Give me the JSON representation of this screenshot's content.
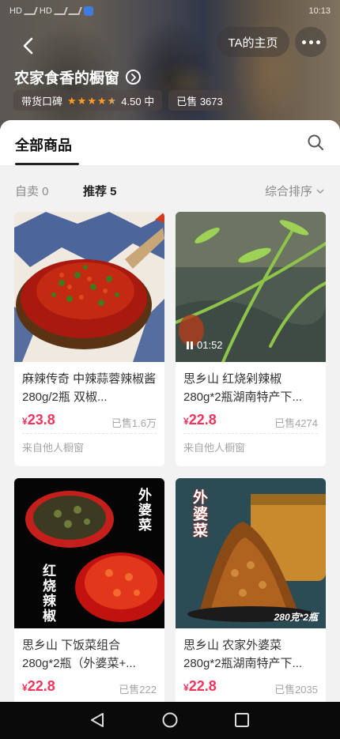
{
  "status_bar": {
    "carrier_1": "HD",
    "carrier_2": "HD",
    "time": "10:13"
  },
  "header": {
    "home_button_label": "TA的主页",
    "shop_name": "农家食香的橱窗",
    "rating_label": "带货口碑",
    "rating_value": 4.5,
    "rating_text": "4.50 中",
    "sold_text": "已售 3673"
  },
  "tabs": {
    "all_products": "全部商品"
  },
  "filters": {
    "self_sold": "自卖 0",
    "recommended": "推荐 5",
    "sort": "综合排序"
  },
  "products": [
    {
      "title": "麻辣传奇 中辣蒜蓉辣椒酱280g/2瓶 双椒...",
      "currency": "¥",
      "price": "23.8",
      "sold": "已售1.6万",
      "source": "来自他人橱窗"
    },
    {
      "title": "思乡山 红烧剁辣椒280g*2瓶湖南特产下...",
      "currency": "¥",
      "price": "22.8",
      "sold": "已售4274",
      "source": "来自他人橱窗",
      "video_duration": "01:52"
    },
    {
      "title": "思乡山 下饭菜组合280g*2瓶（外婆菜+...",
      "currency": "¥",
      "price": "22.8",
      "sold": "已售222",
      "thumb_text_1": "外婆菜",
      "thumb_text_2": "红烧辣椒"
    },
    {
      "title": "思乡山 农家外婆菜280g*2瓶湖南特产下...",
      "currency": "¥",
      "price": "22.8",
      "sold": "已售2035",
      "thumb_text_1": "外婆菜",
      "thumb_text_2": "280克*2瓶"
    }
  ],
  "colors": {
    "price": "#f0345c",
    "star": "#ff9c21"
  },
  "nav": {
    "icons": [
      "back-triangle-icon",
      "home-circle-icon",
      "recent-square-icon"
    ]
  }
}
